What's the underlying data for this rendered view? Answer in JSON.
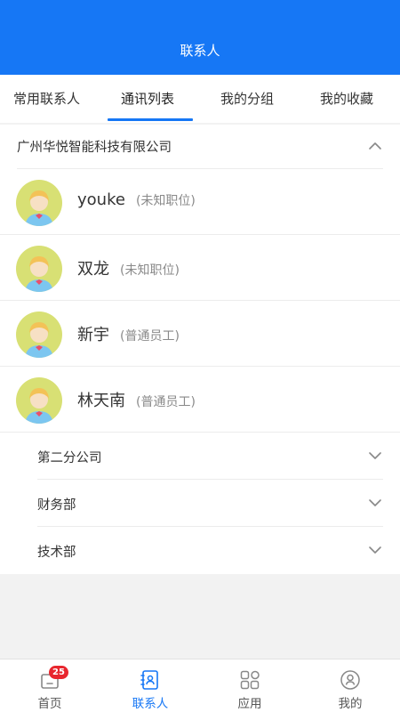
{
  "header": {
    "title": "联系人"
  },
  "tabs": [
    {
      "label": "常用联系人"
    },
    {
      "label": "通讯列表"
    },
    {
      "label": "我的分组"
    },
    {
      "label": "我的收藏"
    }
  ],
  "active_tab": "通讯列表",
  "company": {
    "name": "广州华悦智能科技有限公司",
    "expanded": true
  },
  "contacts": [
    {
      "name": "youke",
      "role": "(未知职位)"
    },
    {
      "name": "双龙",
      "role": "(未知职位)"
    },
    {
      "name": "新宇",
      "role": "(普通员工)"
    },
    {
      "name": "林天南",
      "role": "(普通员工)"
    }
  ],
  "subgroups": [
    {
      "name": "第二分公司"
    },
    {
      "name": "财务部"
    },
    {
      "name": "技术部"
    }
  ],
  "bottom_nav": [
    {
      "label": "首页",
      "icon": "home-icon",
      "badge": "25"
    },
    {
      "label": "联系人",
      "icon": "contacts-icon"
    },
    {
      "label": "应用",
      "icon": "apps-grid-icon"
    },
    {
      "label": "我的",
      "icon": "profile-icon"
    }
  ],
  "colors": {
    "primary": "#1677f5",
    "badge": "#e8262e",
    "avatar_bg": "#d8e074"
  }
}
